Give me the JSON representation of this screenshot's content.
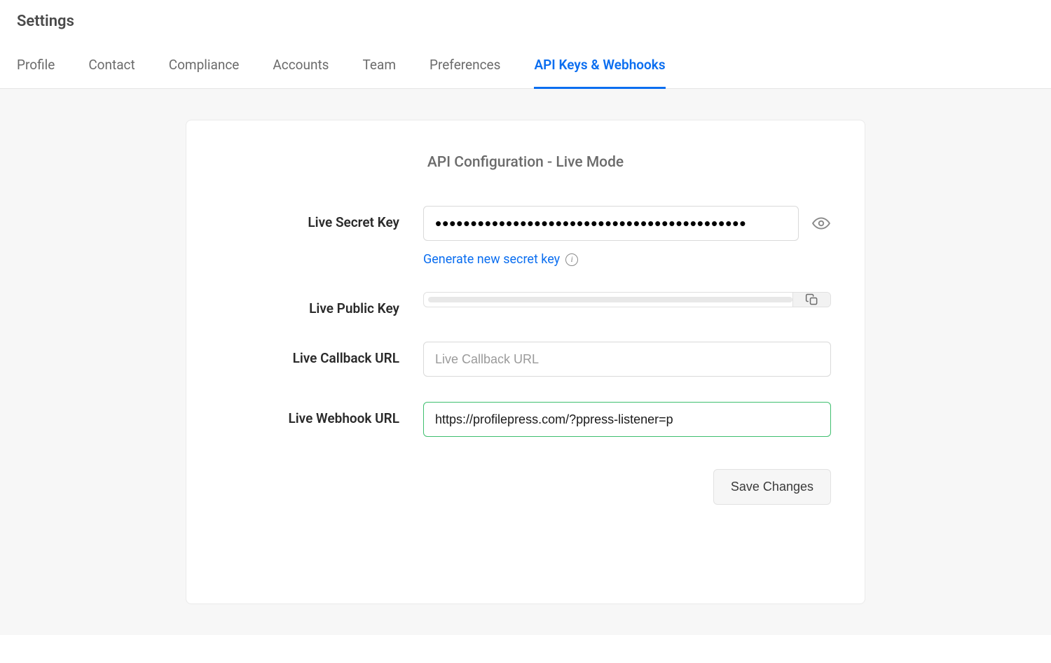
{
  "page_title": "Settings",
  "tabs": [
    {
      "label": "Profile",
      "active": false
    },
    {
      "label": "Contact",
      "active": false
    },
    {
      "label": "Compliance",
      "active": false
    },
    {
      "label": "Accounts",
      "active": false
    },
    {
      "label": "Team",
      "active": false
    },
    {
      "label": "Preferences",
      "active": false
    },
    {
      "label": "API Keys & Webhooks",
      "active": true
    }
  ],
  "card": {
    "title": "API Configuration - Live Mode",
    "secret_key": {
      "label": "Live Secret Key",
      "value": "••••••••••••••••••••••••••••••••••••••••••••",
      "generate_link": "Generate new secret key"
    },
    "public_key": {
      "label": "Live Public Key",
      "value": ""
    },
    "callback_url": {
      "label": "Live Callback URL",
      "placeholder": "Live Callback URL",
      "value": ""
    },
    "webhook_url": {
      "label": "Live Webhook URL",
      "value": "https://profilepress.com/?ppress-listener=p"
    },
    "save_label": "Save Changes"
  },
  "colors": {
    "accent": "#0b6ef0",
    "success_border": "#3fbf6f"
  }
}
